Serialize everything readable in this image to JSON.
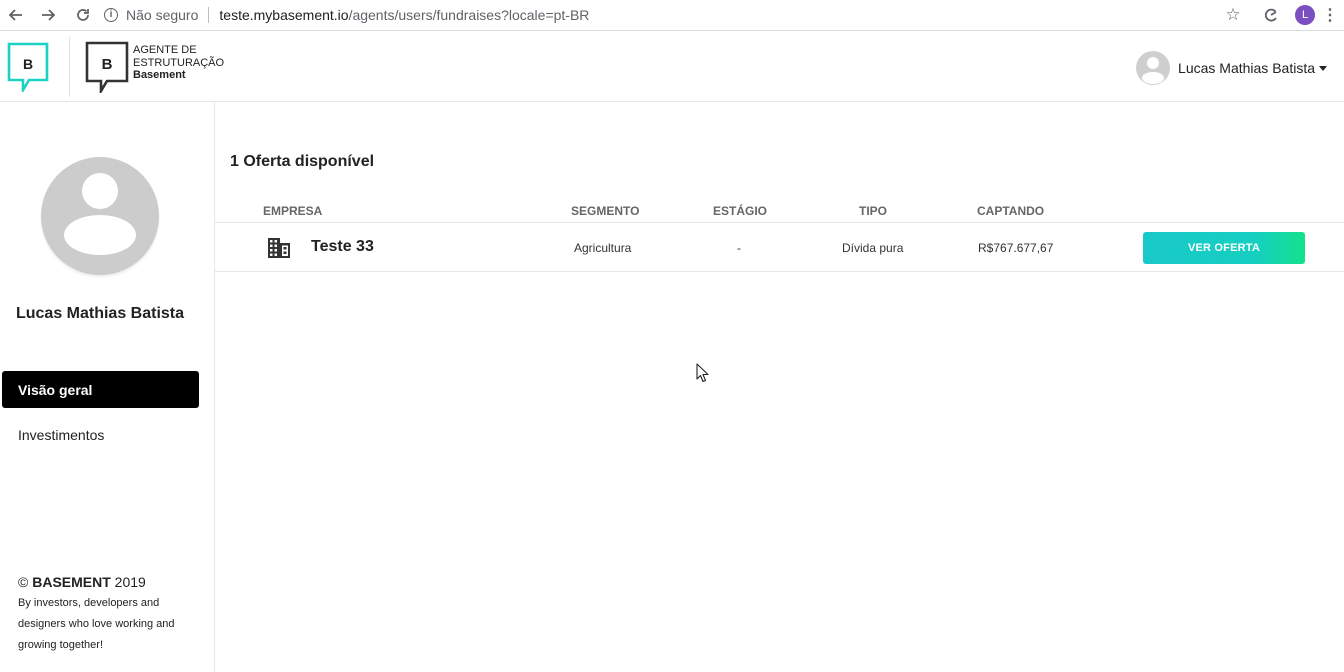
{
  "browser": {
    "security_label": "Não seguro",
    "url_host": "teste.mybasement.io",
    "url_path": "/agents/users/fundraises?locale=pt-BR",
    "profile_initial": "L"
  },
  "header": {
    "logo_letter": "B",
    "brand_line1": "AGENTE DE",
    "brand_line2": "ESTRUTURAÇÃO",
    "brand_line3": "Basement",
    "user_name": "Lucas Mathias Batista"
  },
  "sidebar": {
    "user_name": "Lucas Mathias Batista",
    "items": [
      {
        "label": "Visão geral",
        "active": true
      },
      {
        "label": "Investimentos",
        "active": false
      }
    ],
    "footer": {
      "copyright_symbol": "©",
      "brand": "BASEMENT",
      "year": "2019",
      "tagline_1": "By investors, developers and",
      "tagline_2": "designers who love working and",
      "tagline_3": "growing together!"
    }
  },
  "main": {
    "offers_title": "1 Oferta disponível",
    "columns": [
      "EMPRESA",
      "SEGMENTO",
      "ESTÁGIO",
      "TIPO",
      "CAPTANDO"
    ],
    "rows": [
      {
        "company": "Teste 33",
        "segment": "Agricultura",
        "stage": "-",
        "type": "Dívida pura",
        "raising": "R$767.677,67",
        "cta_label": "VER OFERTA"
      }
    ]
  },
  "colors": {
    "accent_teal": "#18c9c9",
    "accent_green": "#13e28a",
    "active_nav": "#000000",
    "profile": "#7b4fbf"
  }
}
